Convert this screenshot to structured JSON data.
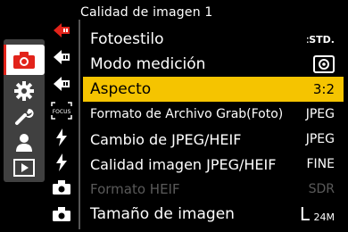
{
  "header": {
    "title": "Calidad de imagen 1"
  },
  "left_tabs": [
    {
      "icon": "camera-icon",
      "selected": true
    },
    {
      "icon": "gear-icon"
    },
    {
      "icon": "wrench-icon"
    },
    {
      "icon": "person-icon"
    },
    {
      "icon": "playback-icon"
    }
  ],
  "sub_tabs": [
    {
      "icon": "red-arrow-icon"
    },
    {
      "icon": "arrow-icon"
    },
    {
      "icon": "arrow-icon"
    },
    {
      "icon": "focus-icon",
      "text": "FOCUS"
    },
    {
      "icon": "bolt-icon"
    },
    {
      "icon": "bolt-icon"
    },
    {
      "icon": "camera-small-icon"
    },
    {
      "icon": "camera-small-icon"
    }
  ],
  "menu": [
    {
      "label": "Fotoestilo",
      "value": "STD.",
      "value_icon": "photo-style-icon"
    },
    {
      "label": "Modo medición",
      "value": "",
      "value_icon": "metering-icon"
    },
    {
      "label": "Aspecto",
      "value": "3:2",
      "selected": true
    },
    {
      "label": "Formato de Archivo Grab(Foto)",
      "value": "JPEG"
    },
    {
      "label": "Cambio de JPEG/HEIF",
      "value": "JPEG"
    },
    {
      "label": "Calidad imagen JPEG/HEIF",
      "value": "FINE"
    },
    {
      "label": "Formato HEIF",
      "value": "SDR",
      "disabled": true
    },
    {
      "label": "Tamaño de imagen",
      "value_prefix": "L",
      "value": "24M"
    }
  ],
  "colors": {
    "accent": "#f5c400",
    "tab_red": "#e2231a",
    "panel": "#404040",
    "disabled": "#5a5a5a"
  }
}
